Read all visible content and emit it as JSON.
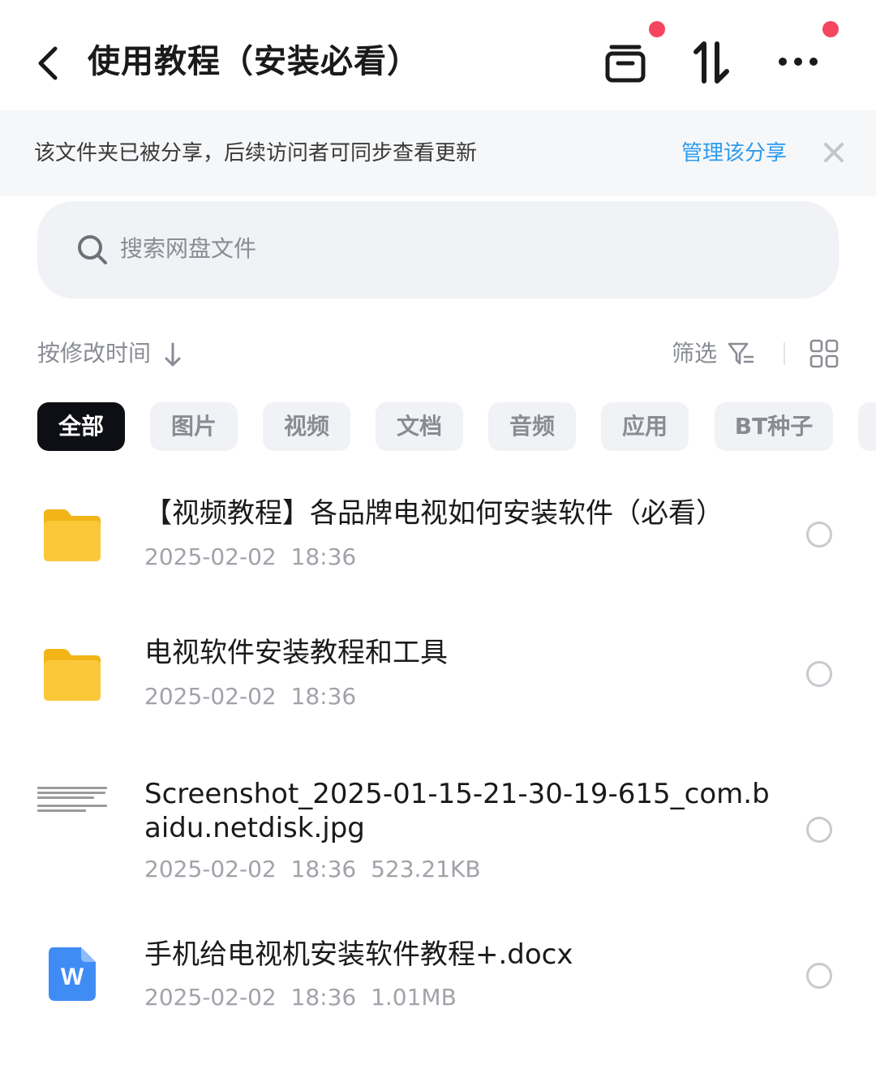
{
  "header": {
    "title": "使用教程（安装必看）",
    "icons": [
      "back-arrow-icon",
      "archive-icon",
      "sort-transfer-icon",
      "more-icon"
    ],
    "badge_color": "#f5455f"
  },
  "banner": {
    "text": "该文件夹已被分享，后续访问者可同步查看更新",
    "link": "管理该分享",
    "link_color": "#2b9bef"
  },
  "search": {
    "placeholder": "搜索网盘文件"
  },
  "toolbar": {
    "sort_label": "按修改时间",
    "filter_label": "筛选"
  },
  "chips": [
    "全部",
    "图片",
    "视频",
    "文档",
    "音频",
    "应用",
    "BT种子"
  ],
  "files": [
    {
      "name": "【视频教程】各品牌电视如何安装软件（必看）",
      "date": "2025-02-02",
      "time": "18:36",
      "size": "",
      "type": "folder"
    },
    {
      "name": "电视软件安装教程和工具",
      "date": "2025-02-02",
      "time": "18:36",
      "size": "",
      "type": "folder"
    },
    {
      "name": "Screenshot_2025-01-15-21-30-19-615_com.baidu.netdisk.jpg",
      "date": "2025-02-02",
      "time": "18:36",
      "size": "523.21KB",
      "type": "image"
    },
    {
      "name": "手机给电视机安装软件教程+.docx",
      "date": "2025-02-02",
      "time": "18:36",
      "size": "1.01MB",
      "type": "word"
    }
  ],
  "word_icon_letter": "W",
  "colors": {
    "folder": "#fbc83a",
    "word": "#3f8cf4",
    "active_chip": "#0e0f14"
  }
}
